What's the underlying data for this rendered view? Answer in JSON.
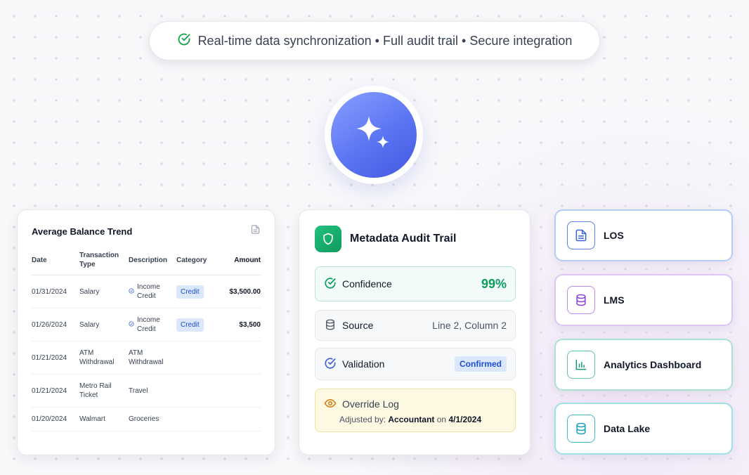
{
  "banner": {
    "text": "Real-time data synchronization • Full audit trail • Secure integration",
    "icon": "check-circle-icon"
  },
  "hub": {
    "icon": "sparkle-icon"
  },
  "table_card": {
    "title": "Average Balance Trend",
    "headers": {
      "date": "Date",
      "type": "Transaction Type",
      "description": "Description",
      "category": "Category",
      "amount": "Amount"
    },
    "rows": [
      {
        "date": "01/31/2024",
        "type": "Salary",
        "description": "Income Credit",
        "category": "Credit",
        "amount": "$3,500.00"
      },
      {
        "date": "01/26/2024",
        "type": "Salary",
        "description": "Income Credit",
        "category": "Credit",
        "amount": "$3,500"
      },
      {
        "date": "01/21/2024",
        "type": "ATM Withdrawal",
        "description": "ATM Withdrawal",
        "category": "",
        "amount": ""
      },
      {
        "date": "01/21/2024",
        "type": "Metro Rail Ticket",
        "description": "Travel",
        "category": "",
        "amount": ""
      },
      {
        "date": "01/20/2024",
        "type": "Walmart",
        "description": "Groceries",
        "category": "",
        "amount": ""
      }
    ]
  },
  "audit_card": {
    "title": "Metadata Audit Trail",
    "confidence": {
      "label": "Confidence",
      "value": "99%"
    },
    "source": {
      "label": "Source",
      "value": "Line 2, Column 2"
    },
    "validation": {
      "label": "Validation",
      "status": "Confirmed"
    },
    "override": {
      "label": "Override Log",
      "prefix": "Adjusted by:",
      "user": "Accountant",
      "on": "on",
      "date": "4/1/2024"
    }
  },
  "systems": [
    {
      "label": "LOS",
      "icon": "document-icon",
      "color": "#3b63d6"
    },
    {
      "label": "LMS",
      "icon": "database-icon",
      "color": "#8b3fd9"
    },
    {
      "label": "Analytics Dashboard",
      "icon": "bar-chart-icon",
      "color": "#139a73"
    },
    {
      "label": "Data Lake",
      "icon": "database-icon",
      "color": "#1aa0b6"
    }
  ],
  "colors": {
    "accent_green": "#0b9b5e",
    "accent_blue": "#1d4ed8",
    "orb_blue": "#5a74f2"
  }
}
